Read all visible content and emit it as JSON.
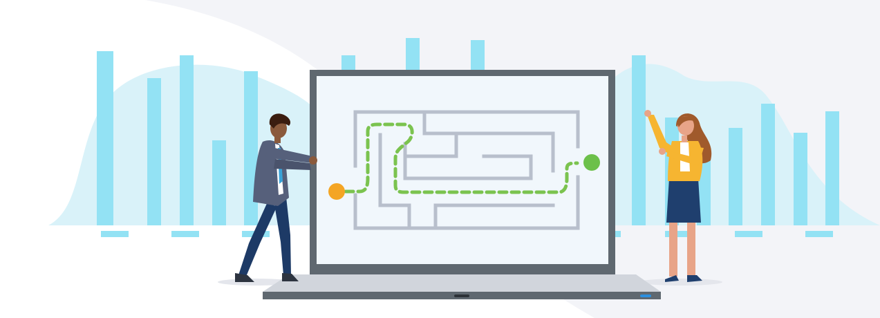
{
  "colors": {
    "background": "#ffffff",
    "backdrop_panel": "#f3f4f8",
    "cloud": "#d9f2f9",
    "bars": "#93e2f4",
    "laptop_frame": "#5f6870",
    "laptop_screen": "#f1f7fc",
    "laptop_base": "#d1d5dc",
    "maze_walls": "#b8bfcc",
    "path": "#7bc34f",
    "start_dot": "#f4a524",
    "end_dot": "#6cc04a",
    "woman_jacket": "#f6b531",
    "woman_skirt": "#1f3f6e",
    "man_jacket": "#56607b",
    "man_pants": "#1d3a66"
  },
  "icons": {
    "maze": "maze-icon",
    "start": "start-dot-icon",
    "end": "end-dot-icon"
  }
}
